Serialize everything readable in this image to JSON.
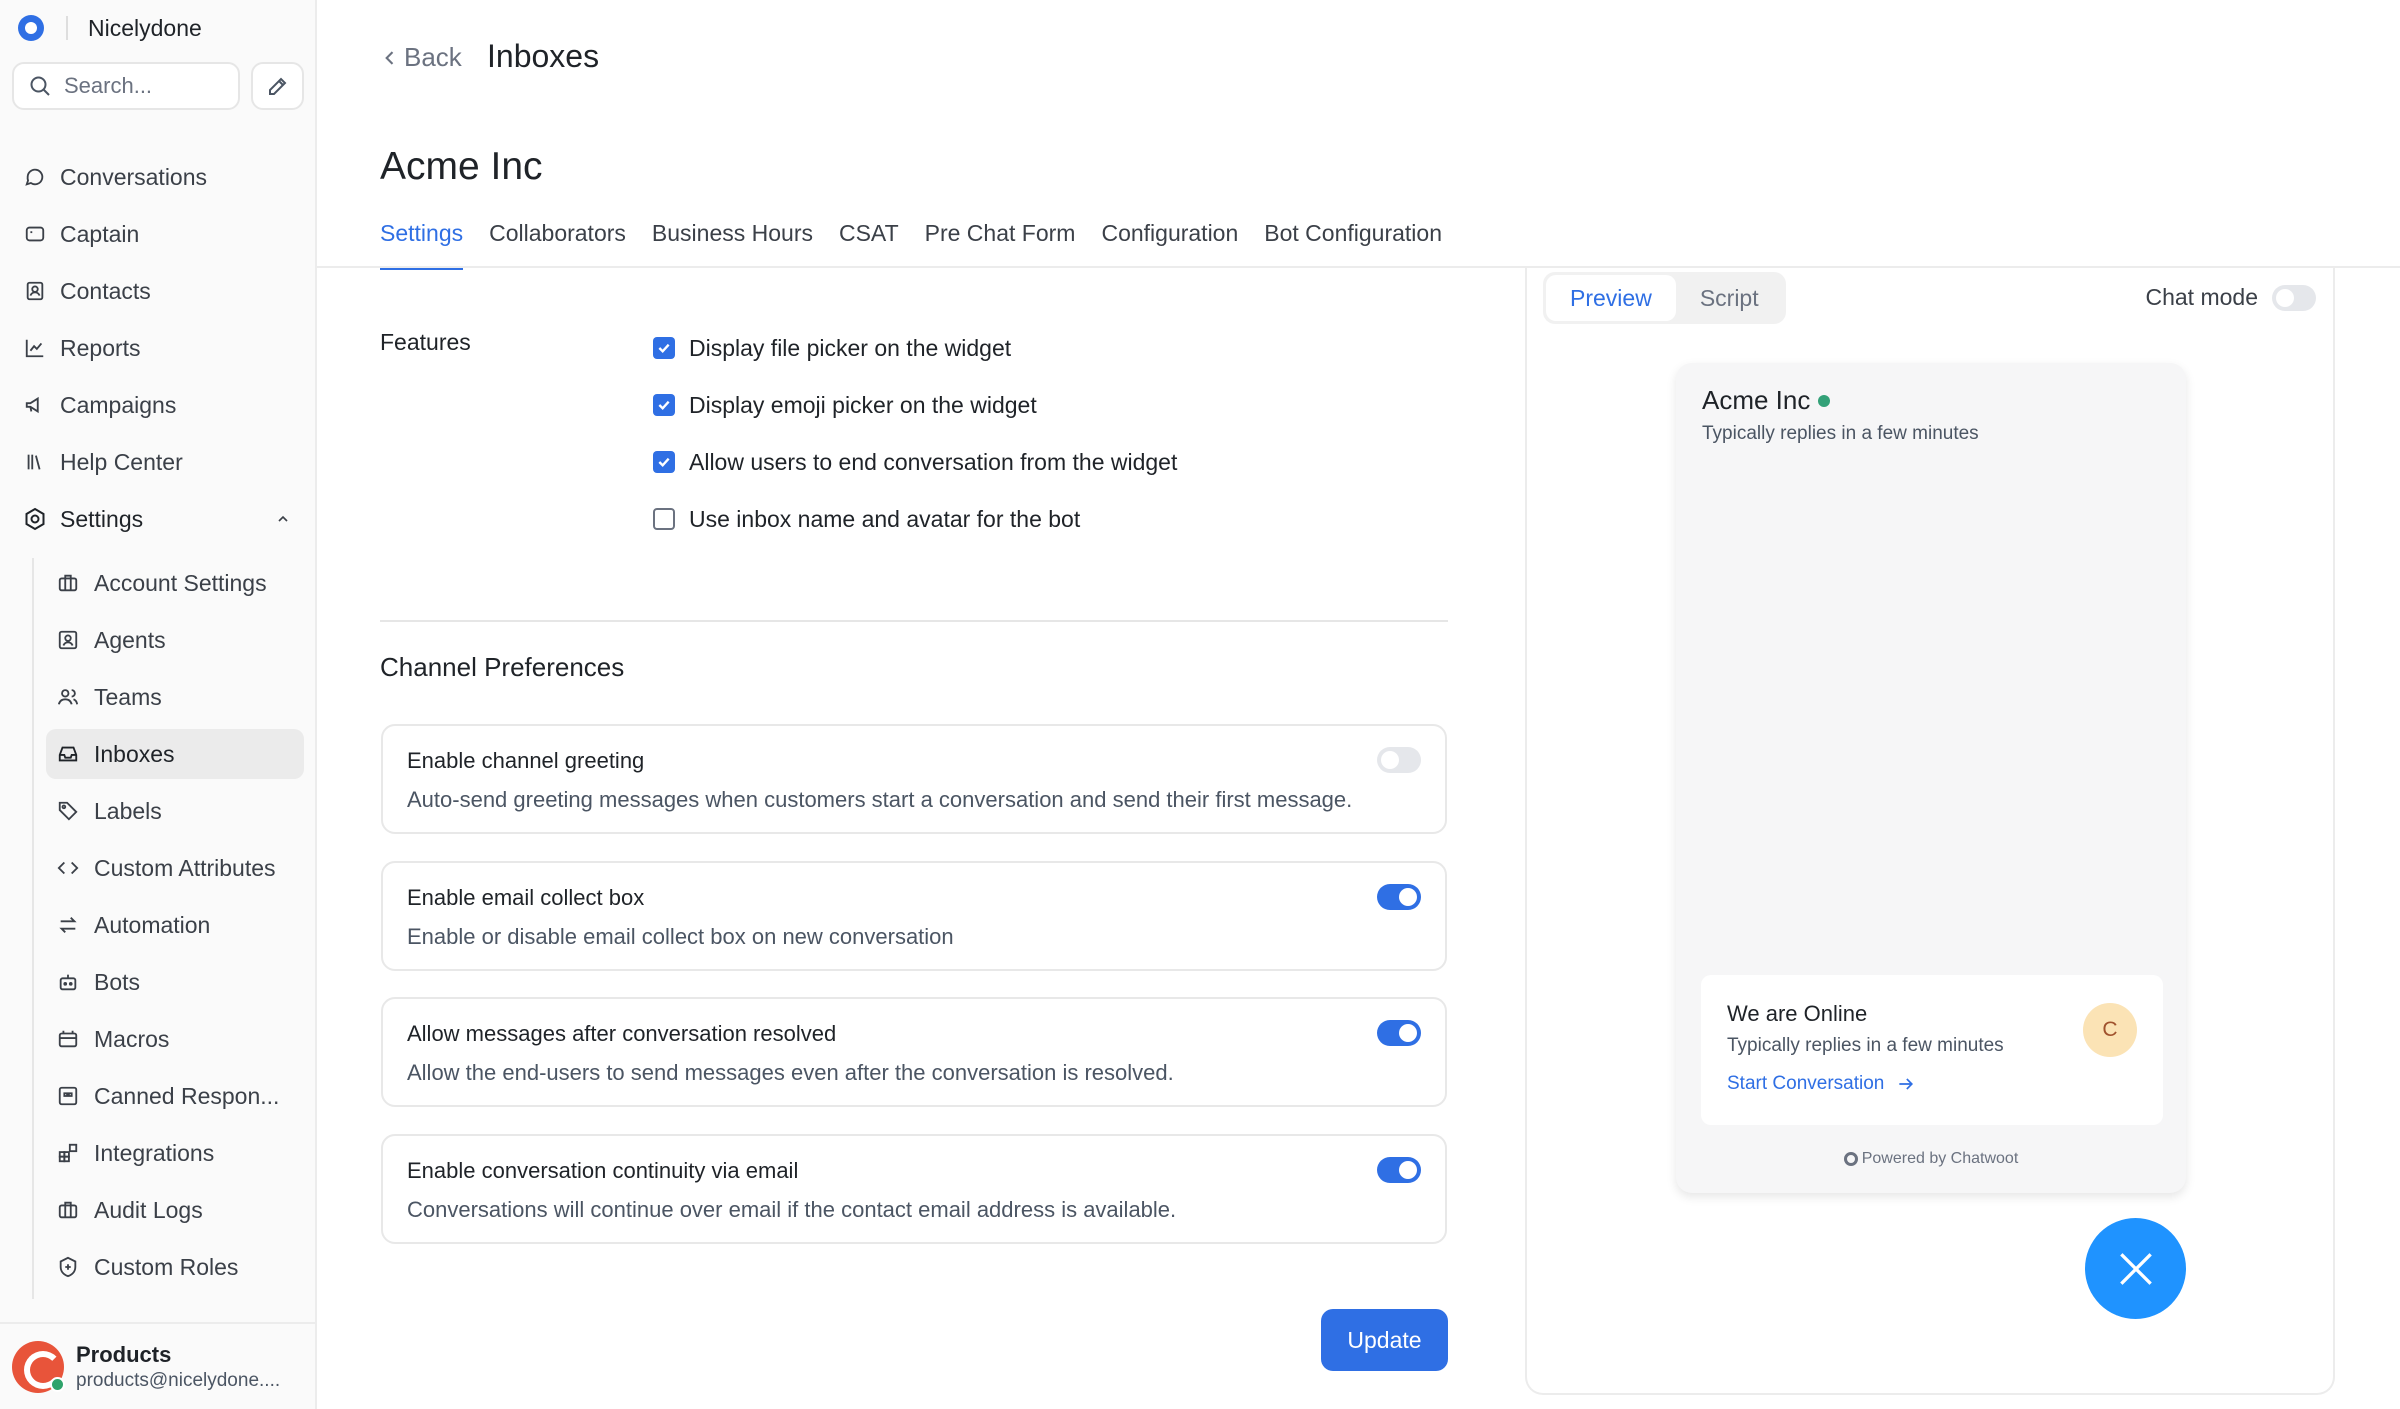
{
  "sidebar": {
    "brand": "Nicelydone",
    "search_placeholder": "Search...",
    "nav": [
      {
        "label": "Conversations",
        "icon": "chat-bubble-icon"
      },
      {
        "label": "Captain",
        "icon": "captain-icon"
      },
      {
        "label": "Contacts",
        "icon": "contact-card-icon"
      },
      {
        "label": "Reports",
        "icon": "chart-line-icon"
      },
      {
        "label": "Campaigns",
        "icon": "megaphone-icon"
      },
      {
        "label": "Help Center",
        "icon": "library-icon"
      },
      {
        "label": "Settings",
        "icon": "gear-icon"
      }
    ],
    "settings_items": [
      {
        "label": "Account Settings",
        "icon": "briefcase-icon"
      },
      {
        "label": "Agents",
        "icon": "agent-icon"
      },
      {
        "label": "Teams",
        "icon": "team-icon"
      },
      {
        "label": "Inboxes",
        "icon": "inbox-icon"
      },
      {
        "label": "Labels",
        "icon": "tag-icon"
      },
      {
        "label": "Custom Attributes",
        "icon": "code-icon"
      },
      {
        "label": "Automation",
        "icon": "arrows-swap-icon"
      },
      {
        "label": "Bots",
        "icon": "bot-icon"
      },
      {
        "label": "Macros",
        "icon": "macro-icon"
      },
      {
        "label": "Canned Respon...",
        "icon": "canned-response-icon"
      },
      {
        "label": "Integrations",
        "icon": "integrations-icon"
      },
      {
        "label": "Audit Logs",
        "icon": "briefcase-icon"
      },
      {
        "label": "Custom Roles",
        "icon": "shield-icon"
      }
    ],
    "active_item": "Inboxes",
    "profile": {
      "name": "Products",
      "email": "products@nicelydone...."
    }
  },
  "header": {
    "back_label": "Back",
    "title": "Inboxes"
  },
  "inbox_name": "Acme Inc",
  "tabs": [
    "Settings",
    "Collaborators",
    "Business Hours",
    "CSAT",
    "Pre Chat Form",
    "Configuration",
    "Bot Configuration"
  ],
  "active_tab": "Settings",
  "features": {
    "label": "Features",
    "items": [
      {
        "label": "Display file picker on the widget",
        "checked": true
      },
      {
        "label": "Display emoji picker on the widget",
        "checked": true
      },
      {
        "label": "Allow users to end conversation from the widget",
        "checked": true
      },
      {
        "label": "Use inbox name and avatar for the bot",
        "checked": false
      }
    ]
  },
  "channel_preferences": {
    "title": "Channel Preferences",
    "items": [
      {
        "title": "Enable channel greeting",
        "desc": "Auto-send greeting messages when customers start a conversation and send their first message.",
        "enabled": false
      },
      {
        "title": "Enable email collect box",
        "desc": "Enable or disable email collect box on new conversation",
        "enabled": true
      },
      {
        "title": "Allow messages after conversation resolved",
        "desc": "Allow the end-users to send messages even after the conversation is resolved.",
        "enabled": true
      },
      {
        "title": "Enable conversation continuity via email",
        "desc": "Conversations will continue over email if the contact email address is available.",
        "enabled": true
      }
    ]
  },
  "update_label": "Update",
  "preview": {
    "tabs": [
      "Preview",
      "Script"
    ],
    "active_tab": "Preview",
    "chat_mode_label": "Chat mode",
    "chat_mode_enabled": false,
    "widget": {
      "title": "Acme Inc",
      "subtitle": "Typically replies in a few minutes",
      "card_title": "We are Online",
      "card_sub": "Typically replies in a few minutes",
      "start_label": "Start Conversation",
      "avatar_initial": "C",
      "powered_by": "Powered by Chatwoot"
    }
  },
  "colors": {
    "accent": "#2f6fe4",
    "fab": "#1f93ff",
    "online": "#33a178"
  }
}
